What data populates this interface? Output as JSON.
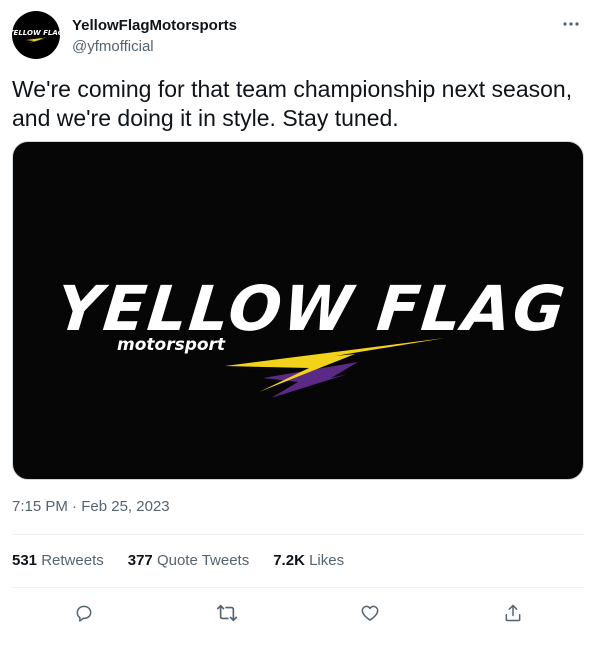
{
  "author": {
    "display_name": "YellowFlagMotorsports",
    "handle": "@yfmofficial",
    "avatar_text": "YELLOW FLAG"
  },
  "tweet": {
    "text": "We're coming for that team championship next season, and we're doing it in style. Stay tuned.",
    "time": "7:15 PM",
    "separator": "·",
    "date": "Feb 25, 2023"
  },
  "media": {
    "logo_title": "YELLOW FLAG",
    "logo_subtitle": "motorsport",
    "colors": {
      "background": "#060606",
      "yellow": "#f2d21a",
      "purple": "#5b2a86",
      "white": "#ffffff"
    }
  },
  "stats": {
    "retweets": {
      "count": "531",
      "label": "Retweets"
    },
    "quotes": {
      "count": "377",
      "label": "Quote Tweets"
    },
    "likes": {
      "count": "7.2K",
      "label": "Likes"
    }
  },
  "actions": {
    "reply": "reply-icon",
    "retweet": "retweet-icon",
    "like": "heart-icon",
    "share": "share-icon"
  },
  "colors": {
    "text": "#0f1419",
    "secondary": "#536471",
    "divider": "#eff3f4"
  }
}
